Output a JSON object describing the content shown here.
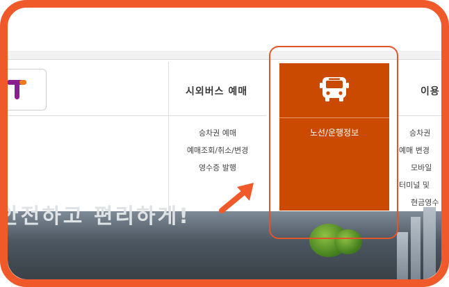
{
  "columns": [
    {
      "title": "시외버스 예매",
      "items": [
        "승차권 예매",
        "예매조회/취소/변경",
        "영수증 발행"
      ]
    },
    {
      "title": "노선/운행정보",
      "icon": "bus-icon"
    },
    {
      "title": "이용",
      "items": [
        "승차권",
        "예매 변경",
        "모바일",
        "터미널 및",
        "현금영수"
      ]
    }
  ],
  "banner": {
    "text": "안전하고 편리하게!"
  },
  "colors": {
    "frame": "#f05a2a",
    "panel": "#c94a00",
    "logo_purple": "#8a1f8f",
    "logo_orange": "#f07a1a"
  }
}
